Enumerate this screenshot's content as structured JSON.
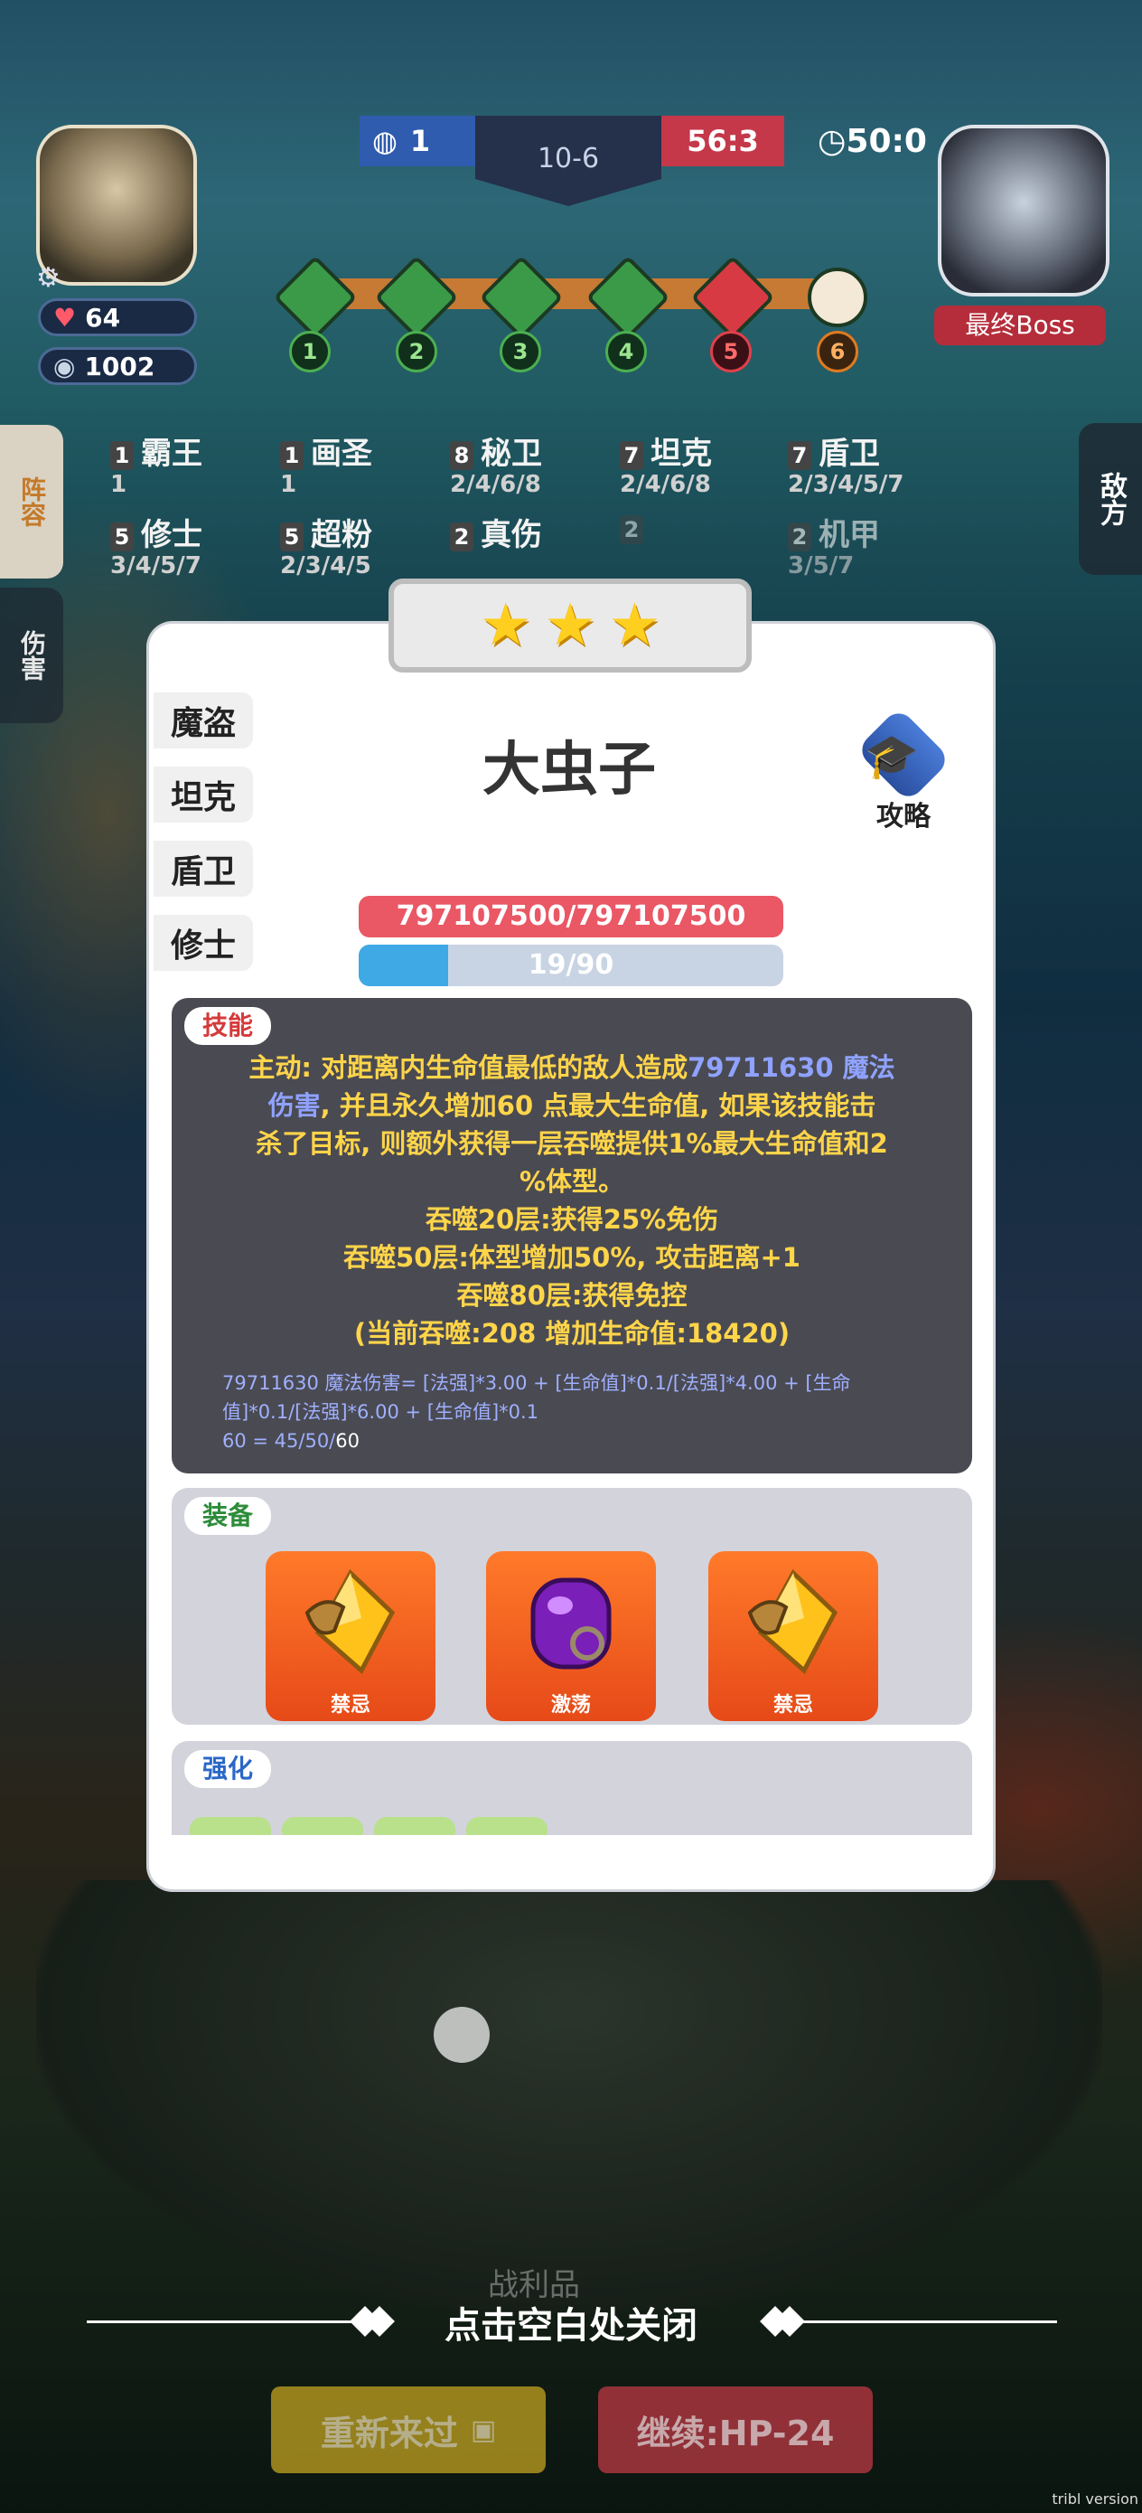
{
  "top": {
    "player_hp": "64",
    "player_gold": "1002",
    "left_score": "1",
    "stage": "10-6",
    "right_score": "56:3",
    "timer": "50:0",
    "boss_label": "最终Boss",
    "waves": [
      "1",
      "2",
      "3",
      "4",
      "5",
      "6"
    ]
  },
  "side_tabs": {
    "lineup": "阵容",
    "damage": "伤害",
    "enemy": "敌方"
  },
  "synergies": [
    {
      "count": "1",
      "name": "霸王",
      "tiers": "1"
    },
    {
      "count": "1",
      "name": "画圣",
      "tiers": "1"
    },
    {
      "count": "8",
      "name": "秘卫",
      "tiers": "2/4/6/8"
    },
    {
      "count": "7",
      "name": "坦克",
      "tiers": "2/4/6/8"
    },
    {
      "count": "7",
      "name": "盾卫",
      "tiers": "2/3/4/5/7"
    },
    {
      "count": "5",
      "name": "修士",
      "tiers": "3/4/5/7"
    },
    {
      "count": "5",
      "name": "超粉",
      "tiers": "2/3/4/5"
    },
    {
      "count": "2",
      "name": "真伤",
      "tiers": ""
    },
    {
      "count": "2",
      "name": "",
      "tiers": ""
    },
    {
      "count": "2",
      "name": "机甲",
      "tiers": "3/5/7"
    }
  ],
  "dialog": {
    "unit_name": "大虫子",
    "roles": [
      "魔盗",
      "坦克",
      "盾卫",
      "修士"
    ],
    "guide_label": "攻略",
    "hp_text": "797107500/797107500",
    "mp_text": "19/90",
    "mp_ratio": 0.21,
    "skill_title": "技能",
    "skill_lines": {
      "l1a": "主动: 对距离内生命值最低的敌人造成",
      "l1b": "79711630 魔法",
      "l2a": "伤害",
      "l2b": ", 并且永久增加60 点最大生命值, 如果该技能击",
      "l3": "杀了目标, 则额外获得一层吞噬提供1%最大生命值和2",
      "l4": "%体型。",
      "l5": "吞噬20层:获得25%免伤",
      "l6": "吞噬50层:体型增加50%, 攻击距离+1",
      "l7": "吞噬80层:获得免控",
      "l8": "(当前吞噬:208 增加生命值:18420)"
    },
    "formula": {
      "f1": "79711630 魔法伤害= [法强]*3.00 + [生命值]*0.1/[法强]*4.00 + [生命",
      "f2": "值]*0.1/[法强]*6.00 + [生命值]*0.1",
      "f3a": "60 = 45/50/",
      "f3b": "60"
    },
    "equip_title": "装备",
    "equips": [
      "禁忌",
      "激荡",
      "禁忌"
    ],
    "boost_title": "强化"
  },
  "close_hint": "点击空白处关闭",
  "ghost_label": "战利品",
  "buttons": {
    "retry": "重新来过",
    "continue": "继续:HP-24"
  },
  "watermark": "tribl version"
}
